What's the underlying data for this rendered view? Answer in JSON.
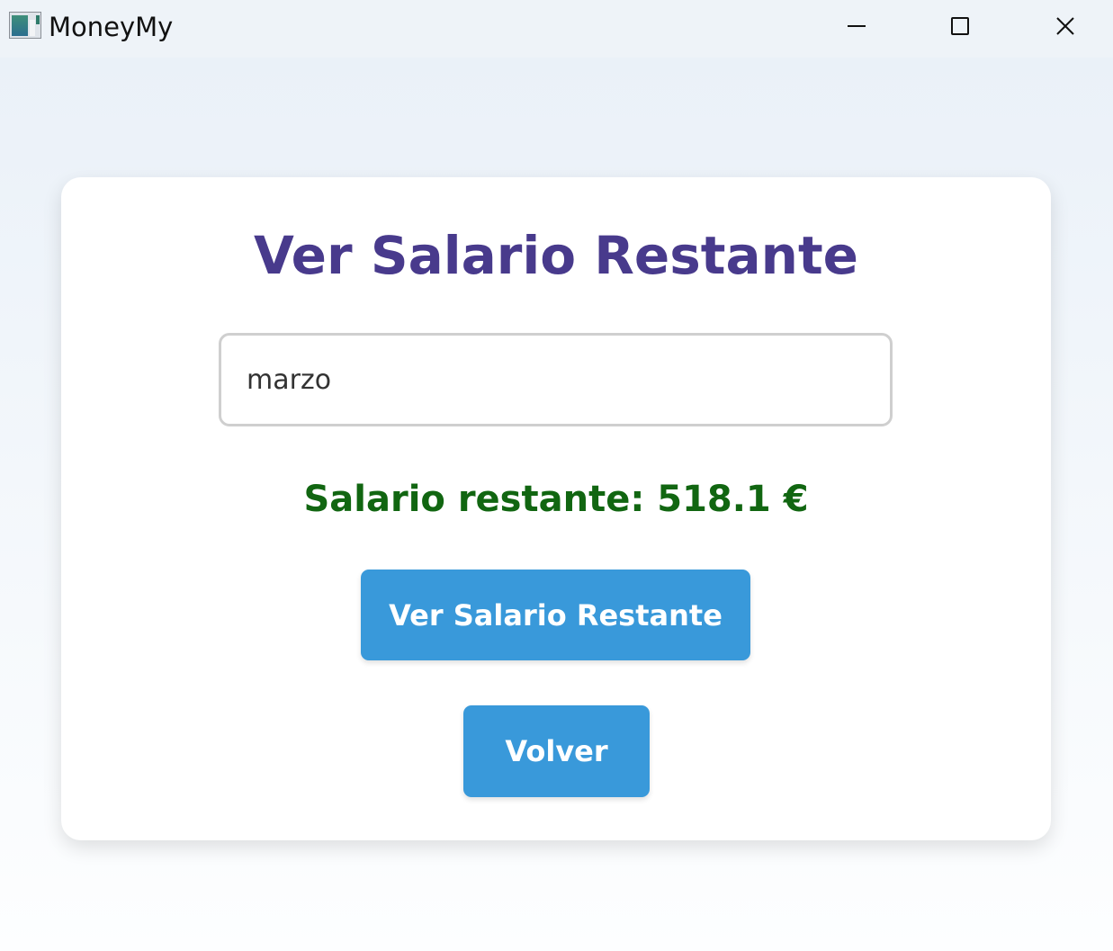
{
  "window": {
    "title": "MoneyMy",
    "controls": {
      "minimize_icon": "minimize-icon",
      "maximize_icon": "maximize-icon",
      "close_icon": "close-icon"
    }
  },
  "card": {
    "heading": "Ver Salario Restante",
    "month_input": {
      "value": "marzo",
      "placeholder": ""
    },
    "result_text": "Salario restante: 518.1 €",
    "show_button_label": "Ver Salario Restante",
    "back_button_label": "Volver"
  },
  "colors": {
    "heading": "#483a8c",
    "result": "#116611",
    "button": "#3999da"
  }
}
